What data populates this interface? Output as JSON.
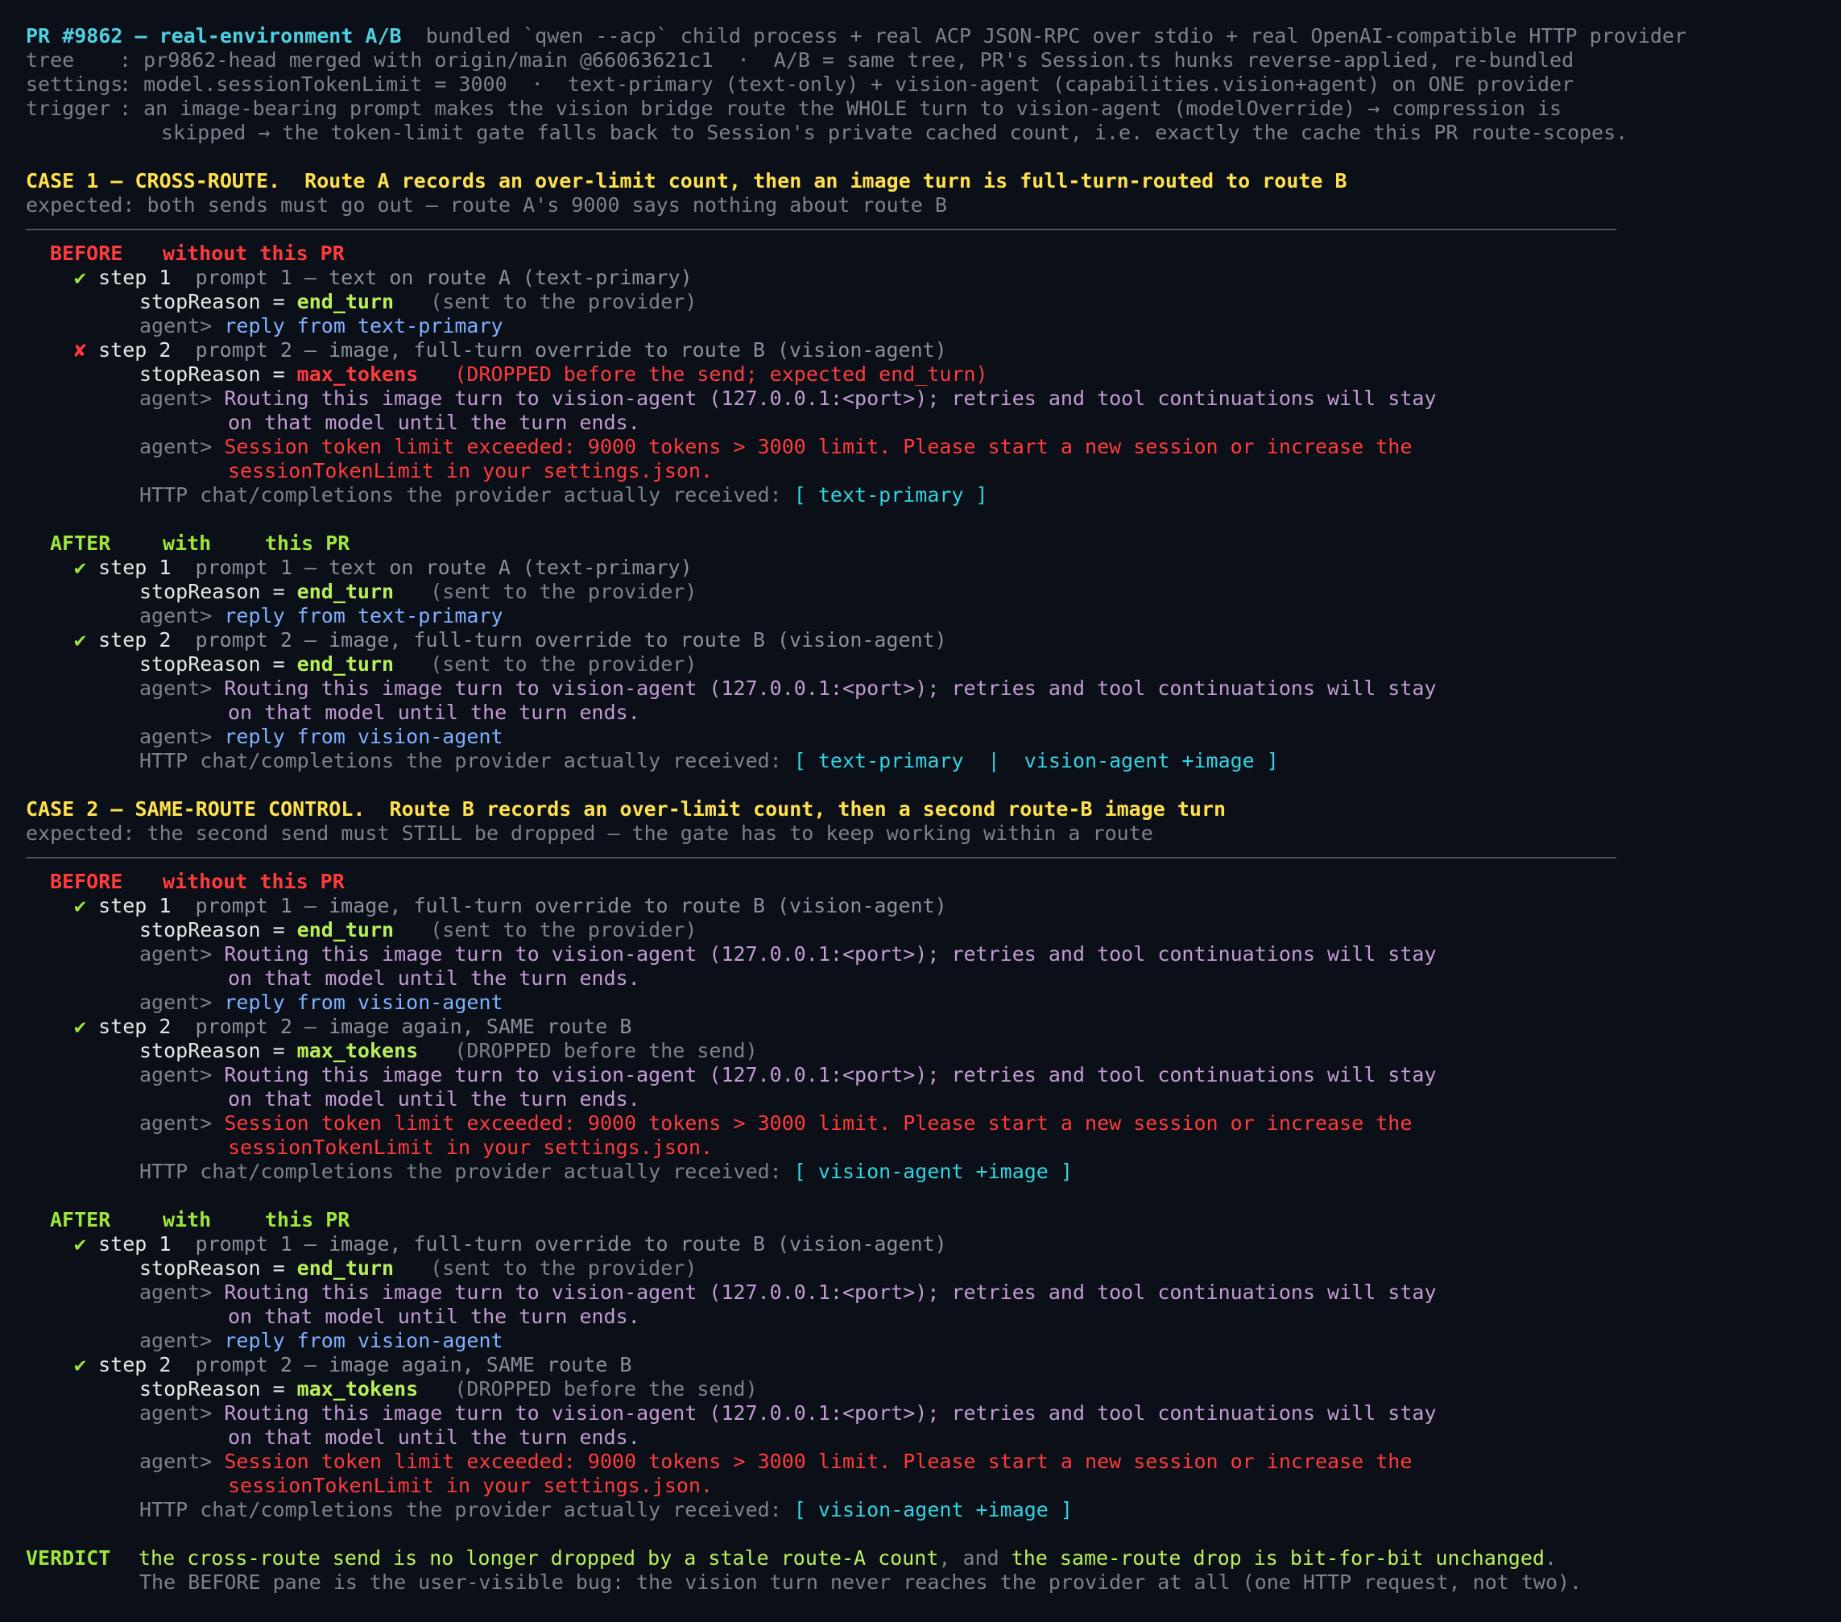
{
  "header": {
    "title": "PR #9862 — real-environment A/B",
    "desc": "bundled `qwen --acp` child process + real ACP JSON-RPC over stdio + real OpenAI-compatible HTTP provider",
    "tree_key": "tree",
    "tree_val": ": pr9862-head merged with origin/main @66063621c1  ·  A/B = same tree, PR's Session.ts hunks reverse-applied, re-bundled",
    "settings_key": "settings",
    "settings_val": ": model.sessionTokenLimit = 3000  ·  text-primary (text-only) + vision-agent (capabilities.vision+agent) on ONE provider",
    "trigger_key": "trigger",
    "trigger_val": ": an image-bearing prompt makes the vision bridge route the WHOLE turn to vision-agent (modelOverride) → compression is",
    "trigger_cont": "skipped → the token-limit gate falls back to Session's private cached count, i.e. exactly the cache this PR route-scopes."
  },
  "common": {
    "step1": "step 1",
    "step2": "step 2",
    "stop_label": "stopReason = ",
    "agent": "agent>",
    "routing1": "Routing this image turn to vision-agent (127.0.0.1:<port>); retries and tool continuations will stay",
    "routing2": "on that model until the turn ends.",
    "limit1": "Session token limit exceeded: 9000 tokens > 3000 limit. Please start a new session or increase the",
    "limit2": "sessionTokenLimit in your settings.json.",
    "http_label": "HTTP chat/completions the provider actually received: ",
    "end_turn": "end_turn",
    "max_tokens": "max_tokens",
    "sent": "(sent to the provider)",
    "dropped_plain": "(DROPPED before the send)",
    "check": "✔",
    "cross": "✘"
  },
  "case1": {
    "title": "CASE 1 — CROSS-ROUTE.  Route A records an over-limit count, then an image turn is full-turn-routed to route B",
    "expected": "expected: both sends must go out — route A's 9000 says nothing about route B",
    "before_label": "BEFORE",
    "before_note": "without this PR",
    "after_label": "AFTER",
    "after_with": "with",
    "after_note": "this PR",
    "p1": "prompt 1 — text on route A (text-primary)",
    "p2": "prompt 2 — image, full-turn override to route B (vision-agent)",
    "reply_text": "reply from text-primary",
    "reply_vision": "reply from vision-agent",
    "dropped_expected": "(DROPPED before the send; expected end_turn)",
    "http_before": "[ text-primary ]",
    "http_after": "[ text-primary  |  vision-agent +image ]"
  },
  "case2": {
    "title": "CASE 2 — SAME-ROUTE CONTROL.  Route B records an over-limit count, then a second route-B image turn",
    "expected": "expected: the second send must STILL be dropped — the gate has to keep working within a route",
    "before_label": "BEFORE",
    "before_note": "without this PR",
    "after_label": "AFTER",
    "after_with": "with",
    "after_note": "this PR",
    "p1": "prompt 1 — image, full-turn override to route B (vision-agent)",
    "p2": "prompt 2 — image again, SAME route B",
    "reply_vision": "reply from vision-agent",
    "http_before": "[ vision-agent +image ]",
    "http_after": "[ vision-agent +image ]"
  },
  "verdict": {
    "label": "VERDICT",
    "part1": "the cross-route send is no longer dropped by a stale route-A count",
    "comma_and": ", and ",
    "part2": "the same-route drop is bit-for-bit unchanged",
    "period": ".",
    "line2": "The BEFORE pane is the user-visible bug: the vision turn never reaches the provider at all (one HTTP request, not two)."
  }
}
